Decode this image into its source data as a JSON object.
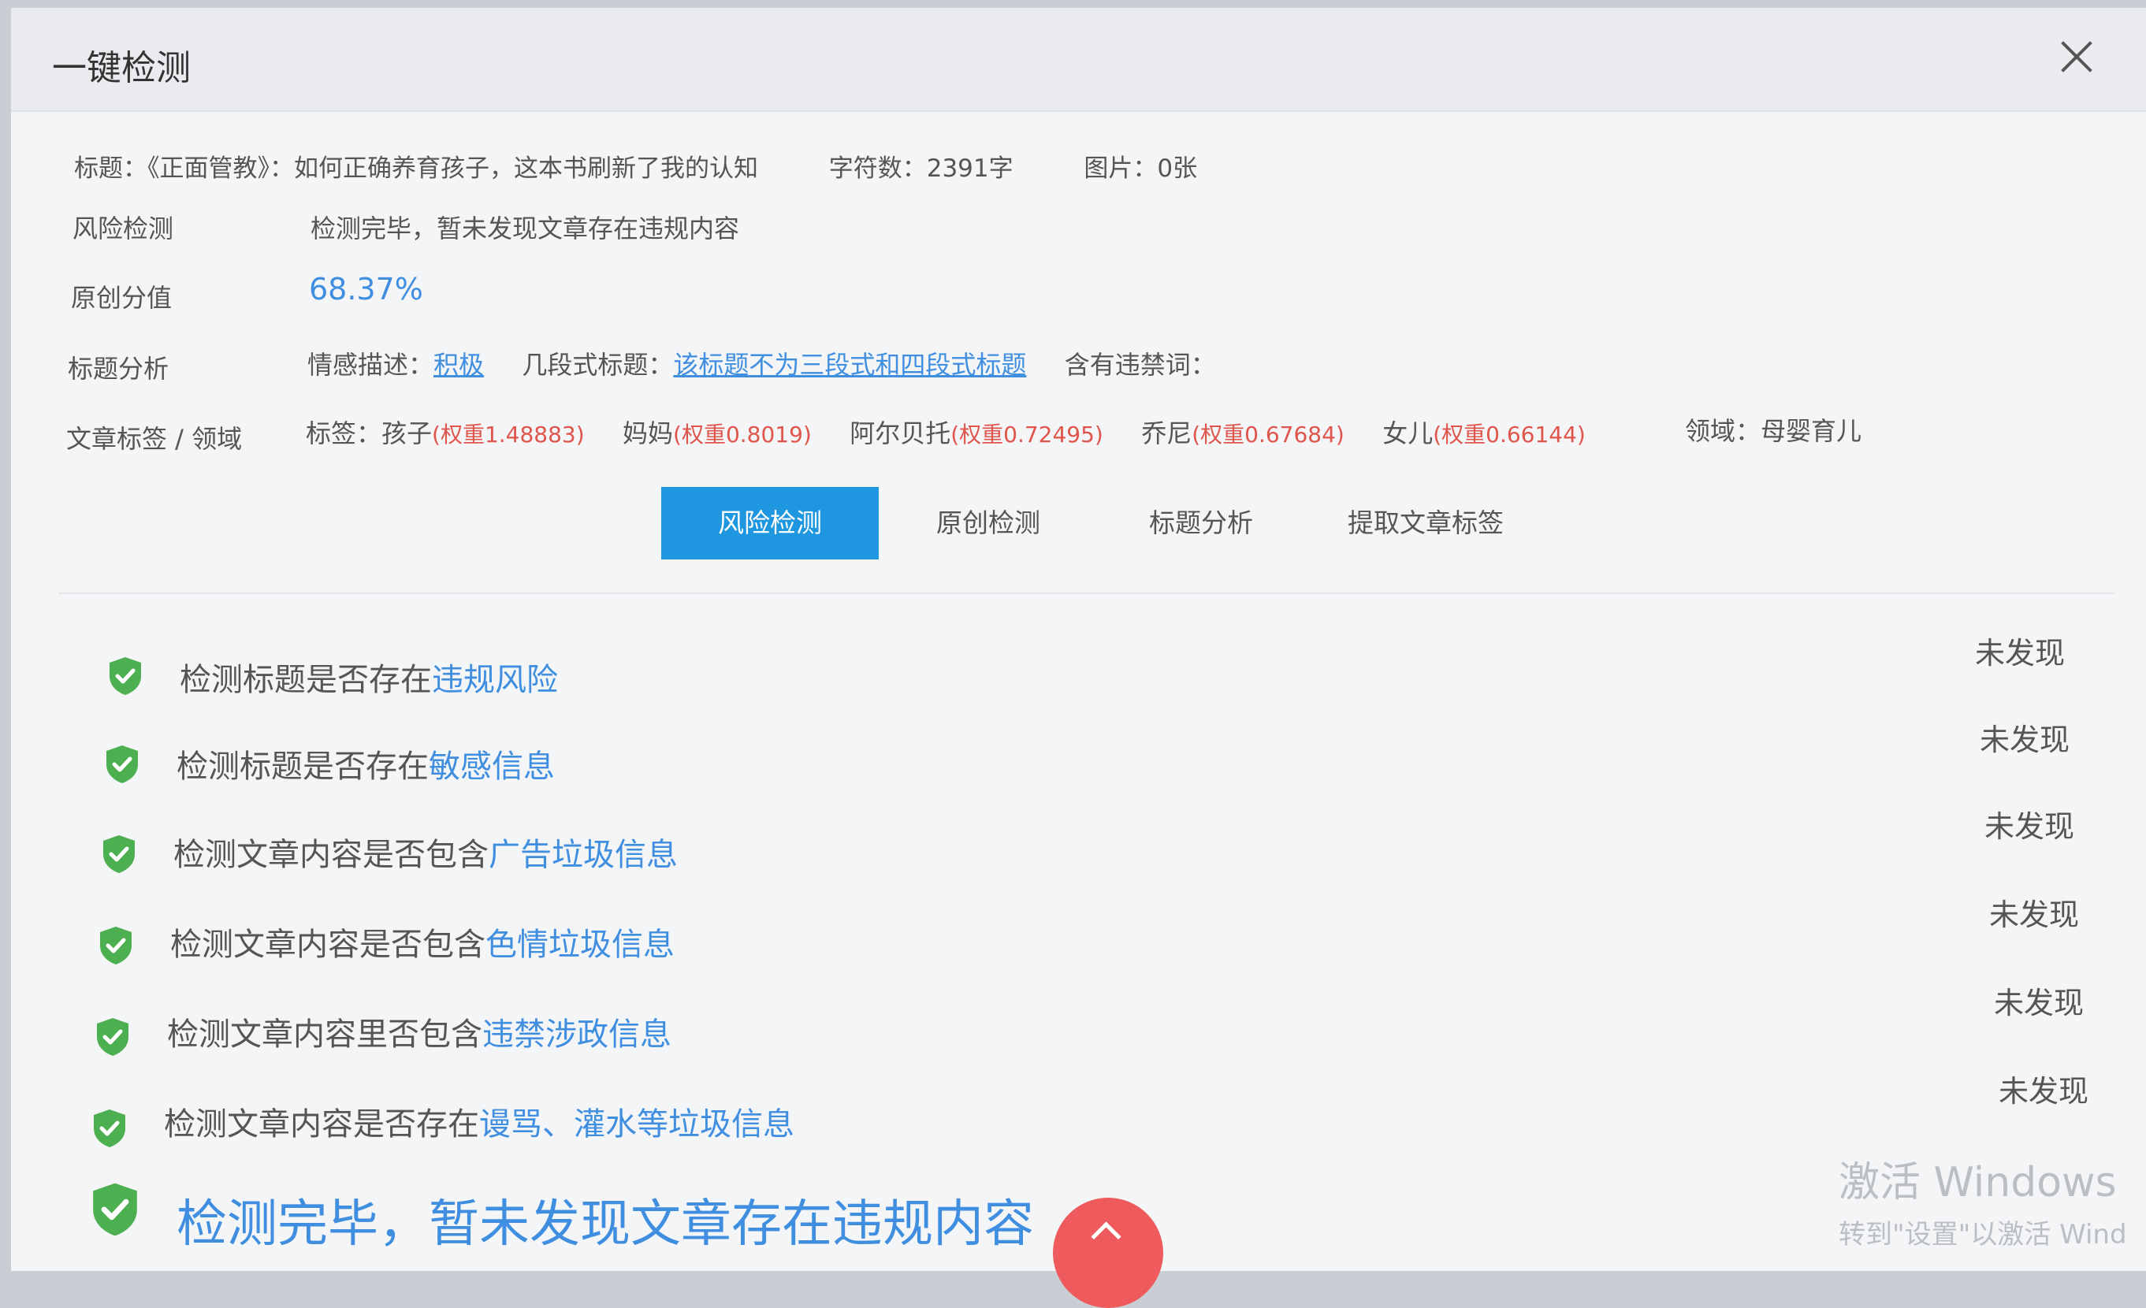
{
  "dialog": {
    "title": "一键检测"
  },
  "meta": {
    "title_label": "标题：",
    "title_value": "《正面管教》：如何正确养育孩子，这本书刷新了我的认知",
    "char_count": "字符数：2391字",
    "images": "图片：0张"
  },
  "risk": {
    "label": "风险检测",
    "value": "检测完毕，暂未发现文章存在违规内容"
  },
  "originality": {
    "label": "原创分值",
    "value": "68.37%"
  },
  "title_analysis": {
    "label": "标题分析",
    "sentiment_label": "情感描述：",
    "sentiment_value": "积极",
    "segment_label": "几段式标题：",
    "segment_value": "该标题不为三段式和四段式标题",
    "banned_label": "含有违禁词："
  },
  "tags": {
    "label": "文章标签 / 领域",
    "prefix": "标签：",
    "items": [
      {
        "name": "孩子",
        "weight": "(权重1.48883)"
      },
      {
        "name": "妈妈",
        "weight": "(权重0.8019)"
      },
      {
        "name": "阿尔贝托",
        "weight": "(权重0.72495)"
      },
      {
        "name": "乔尼",
        "weight": "(权重0.67684)"
      },
      {
        "name": "女儿",
        "weight": "(权重0.66144)"
      }
    ],
    "domain": "领域：母婴育儿"
  },
  "tabs": [
    {
      "label": "风险检测",
      "active": true
    },
    {
      "label": "原创检测",
      "active": false
    },
    {
      "label": "标题分析",
      "active": false
    },
    {
      "label": "提取文章标签",
      "active": false
    }
  ],
  "checks": [
    {
      "text": "检测标题是否存在",
      "highlight": "违规风险",
      "status": "未发现"
    },
    {
      "text": "检测标题是否存在",
      "highlight": "敏感信息",
      "status": "未发现"
    },
    {
      "text": "检测文章内容是否包含",
      "highlight": "广告垃圾信息",
      "status": "未发现"
    },
    {
      "text": "检测文章内容是否包含",
      "highlight": "色情垃圾信息",
      "status": "未发现"
    },
    {
      "text": "检测文章内容里否包含",
      "highlight": "违禁涉政信息",
      "status": "未发现"
    },
    {
      "text": "检测文章内容是否存在",
      "highlight": "谩骂、灌水等垃圾信息",
      "status": "未发现"
    }
  ],
  "summary": {
    "text": "检测完毕，暂未发现文章存在违规内容"
  },
  "watermark": {
    "line1": "激活 Windows",
    "line2": "转到\"设置\"以激活 Wind"
  },
  "colors": {
    "accent": "#1e96e0",
    "link": "#3f8ee0",
    "weight": "#e0554b",
    "shield": "#4caf50",
    "scroll_up": "#ef5a5c"
  }
}
